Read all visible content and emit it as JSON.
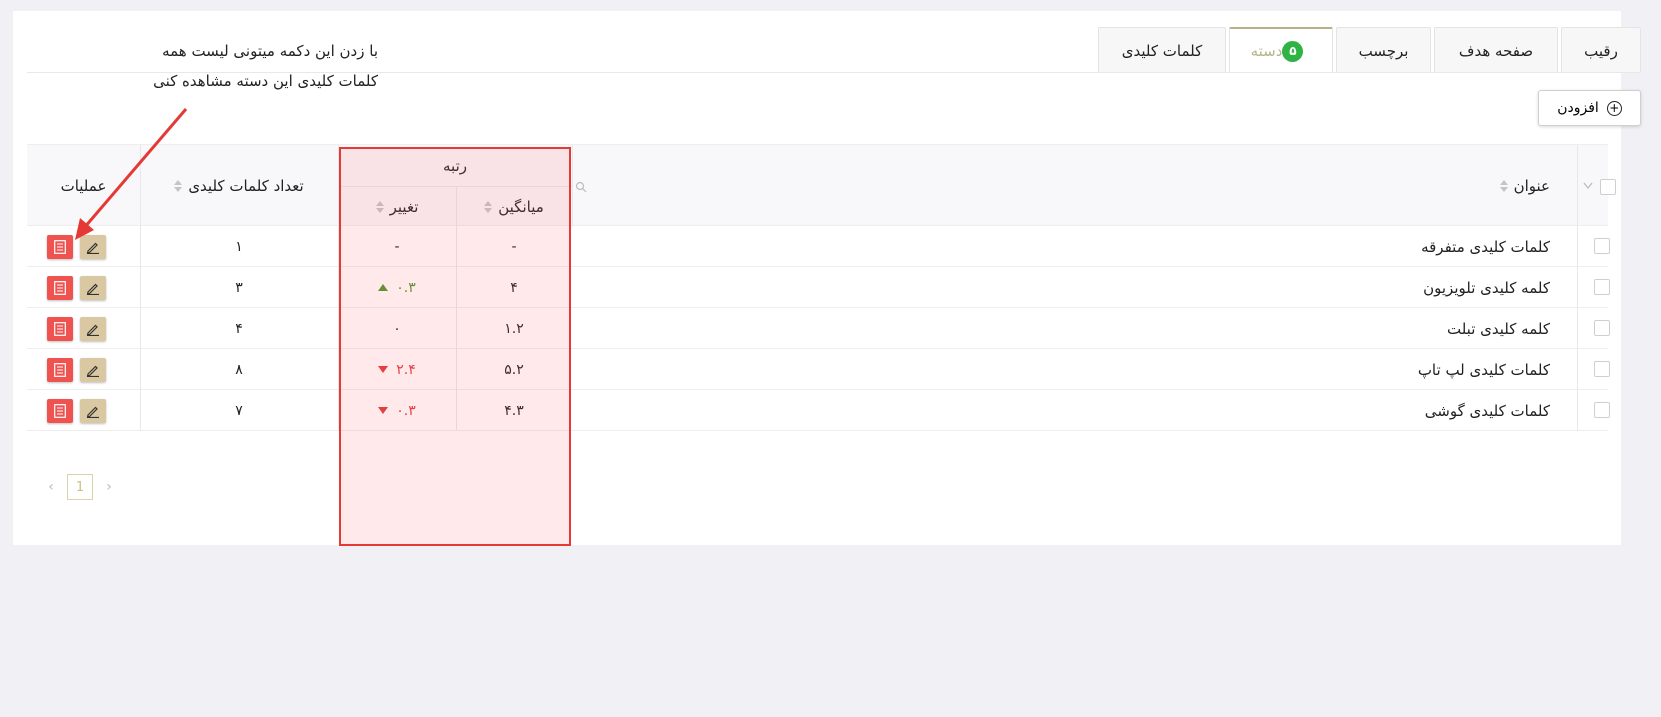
{
  "tabs": [
    {
      "label": "کلمات کلیدی",
      "active": false
    },
    {
      "label": "دسته",
      "badge": "۵",
      "active": true
    },
    {
      "label": "برچسب",
      "active": false
    },
    {
      "label": "صفحه هدف",
      "active": false
    },
    {
      "label": "رقیب",
      "active": false
    }
  ],
  "toolbar": {
    "add_label": "افزودن"
  },
  "columns": {
    "title": "عنوان",
    "rank": "رتبه",
    "average": "میانگین",
    "change": "تغییر",
    "keyword_count": "تعداد کلمات کلیدی",
    "actions": "عملیات"
  },
  "rows": [
    {
      "title": "کلمات کلیدی متفرقه",
      "average": "-",
      "change": "-",
      "trend": "none",
      "count": "۱"
    },
    {
      "title": "کلمه کلیدی تلویزیون",
      "average": "۴",
      "change": "۰.۳",
      "trend": "up",
      "count": "۳"
    },
    {
      "title": "کلمه کلیدی تبلت",
      "average": "۱.۲",
      "change": "۰",
      "trend": "none",
      "count": "۴"
    },
    {
      "title": "کلمات کلیدی لپ تاپ",
      "average": "۵.۲",
      "change": "۲.۴",
      "trend": "down",
      "count": "۸"
    },
    {
      "title": "کلمات کلیدی گوشی",
      "average": "۴.۳",
      "change": "۰.۳",
      "trend": "down",
      "count": "۷"
    }
  ],
  "pagination": {
    "current": "1"
  },
  "annotation": {
    "line1": "با زدن این دکمه میتونی لیست همه",
    "line2": "کلمات کلیدی این دسته مشاهده کنی"
  },
  "colors": {
    "accent": "#b6b38a",
    "badge": "#2fb344",
    "up": "#4a9a2a",
    "down": "#e03b3b",
    "highlight": "#e53935"
  }
}
